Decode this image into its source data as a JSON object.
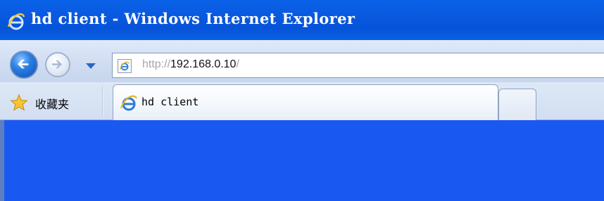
{
  "window": {
    "title": "hd client - Windows Internet Explorer"
  },
  "nav": {
    "address": {
      "scheme": "http://",
      "host": "192.168.0.10",
      "trail": "/"
    }
  },
  "tabbar": {
    "favorites_label": "收藏夹",
    "tabs": [
      {
        "label": "hd client"
      }
    ]
  },
  "colors": {
    "titlebar": "#0a5ae0",
    "content": "#1a58f2",
    "navbar": "#d2dff1"
  },
  "icons": {
    "title": "ie-logo-icon",
    "back": "back-arrow-icon",
    "forward": "forward-arrow-icon",
    "history": "chevron-down-icon",
    "page": "ie-page-icon",
    "favorites": "star-icon",
    "tab": "ie-logo-icon"
  }
}
